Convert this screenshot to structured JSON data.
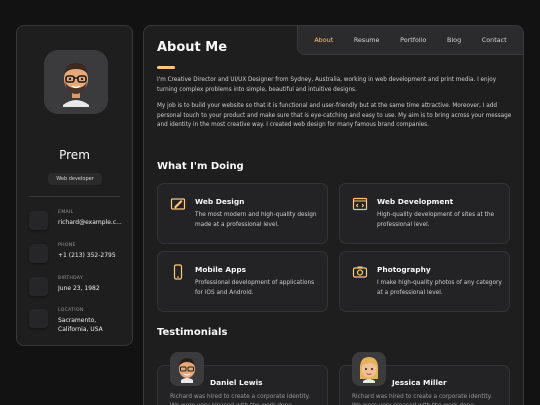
{
  "sidebar": {
    "name": "Prem",
    "title": "Web developer",
    "contacts": [
      {
        "label": "EMAIL",
        "value": "richard@example.c...",
        "icon": "mail-icon"
      },
      {
        "label": "PHONE",
        "value": "+1 (213) 352-2795",
        "icon": "phone-icon"
      },
      {
        "label": "BIRTHDAY",
        "value": "June 23, 1982",
        "icon": "calendar-icon"
      },
      {
        "label": "LOCATION",
        "value": "Sacramento, California, USA",
        "icon": "location-icon"
      }
    ]
  },
  "nav": {
    "items": [
      "About",
      "Resume",
      "Portfolio",
      "Blog",
      "Contact"
    ],
    "active": "About"
  },
  "about": {
    "heading": "About Me",
    "p1": "I'm Creative Director and UI/UX Designer from Sydney, Australia, working in web development and print media. I enjoy turning complex problems into simple, beautiful and intuitive designs.",
    "p2": "My job is to build your website so that it is functional and user-friendly but at the same time attractive. Moreover, I add personal touch to your product and make sure that is eye-catching and easy to use. My aim is to bring across your message and identity in the most creative way. I created web design for many famous brand companies."
  },
  "services": {
    "heading": "What I'm Doing",
    "items": [
      {
        "title": "Web Design",
        "desc": "The most modern and high-quality design made at a professional level.",
        "icon": "design-icon"
      },
      {
        "title": "Web Development",
        "desc": "High-quality development of sites at the professional level.",
        "icon": "code-icon"
      },
      {
        "title": "Mobile Apps",
        "desc": "Professional development of applications for iOS and Android.",
        "icon": "mobile-icon"
      },
      {
        "title": "Photography",
        "desc": "I make high-quality photos of any category at a professional level.",
        "icon": "camera-icon"
      }
    ]
  },
  "testimonials": {
    "heading": "Testimonials",
    "items": [
      {
        "name": "Daniel Lewis",
        "text": "Richard was hired to create a corporate identity. We were very pleased with the work done."
      },
      {
        "name": "Jessica Miller",
        "text": "Richard was hired to create a corporate identity. We were very pleased with the work done."
      }
    ]
  },
  "colors": {
    "accent": "#ffc67a",
    "background": "#121212",
    "panel": "#1e1e1f"
  }
}
